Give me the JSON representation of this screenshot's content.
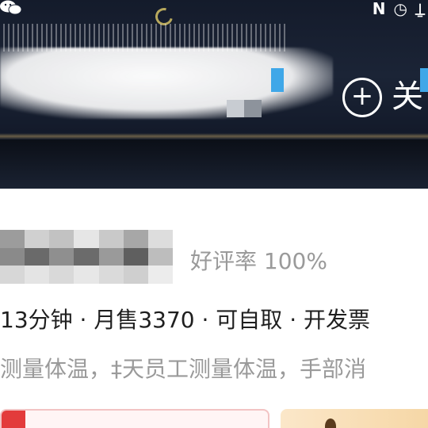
{
  "status_bar": {
    "left_icon": "wechat-icon",
    "right_icons": [
      "nfc-icon",
      "clock-icon",
      "notification-icon"
    ]
  },
  "banner": {
    "favorite_icon": "favorite-plus-icon",
    "favorite_label": "关"
  },
  "shop": {
    "rating": "好评率 100%",
    "meta": "13分钟 · 月售3370 · 可自取 · 开发票",
    "notice": "测量体温，‡天员工测量体温，手部消"
  },
  "colors": {
    "accent_red": "#e33b3b",
    "muted_text": "#9a9a9a",
    "primary_text": "#1f1f1f",
    "coupon_gold": "#f6d7a6"
  }
}
